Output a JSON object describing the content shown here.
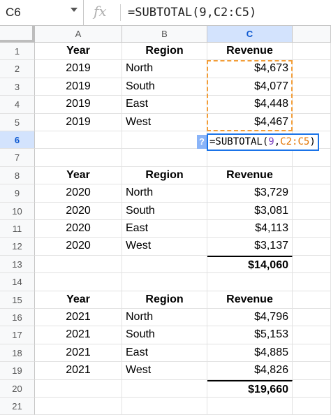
{
  "formula_bar": {
    "cell_ref": "C6",
    "fx_label": "fx",
    "formula": "=SUBTOTAL(9,C2:C5)"
  },
  "columns": [
    "A",
    "B",
    "C"
  ],
  "rows": [
    {
      "num": "1",
      "a": "Year",
      "b": "Region",
      "c": "Revenue",
      "header": true
    },
    {
      "num": "2",
      "a": "2019",
      "b": "North",
      "c": "$4,673"
    },
    {
      "num": "3",
      "a": "2019",
      "b": "South",
      "c": "$4,077"
    },
    {
      "num": "4",
      "a": "2019",
      "b": "East",
      "c": "$4,448"
    },
    {
      "num": "5",
      "a": "2019",
      "b": "West",
      "c": "$4,467"
    },
    {
      "num": "6",
      "a": "",
      "b": "",
      "c": ""
    },
    {
      "num": "7",
      "a": "",
      "b": "",
      "c": ""
    },
    {
      "num": "8",
      "a": "Year",
      "b": "Region",
      "c": "Revenue",
      "header": true
    },
    {
      "num": "9",
      "a": "2020",
      "b": "North",
      "c": "$3,729"
    },
    {
      "num": "10",
      "a": "2020",
      "b": "South",
      "c": "$3,081"
    },
    {
      "num": "11",
      "a": "2020",
      "b": "East",
      "c": "$4,113"
    },
    {
      "num": "12",
      "a": "2020",
      "b": "West",
      "c": "$3,137"
    },
    {
      "num": "13",
      "a": "",
      "b": "",
      "c": "$14,060",
      "total": true
    },
    {
      "num": "14",
      "a": "",
      "b": "",
      "c": ""
    },
    {
      "num": "15",
      "a": "Year",
      "b": "Region",
      "c": "Revenue",
      "header": true
    },
    {
      "num": "16",
      "a": "2021",
      "b": "North",
      "c": "$4,796"
    },
    {
      "num": "17",
      "a": "2021",
      "b": "South",
      "c": "$5,153"
    },
    {
      "num": "18",
      "a": "2021",
      "b": "East",
      "c": "$4,885"
    },
    {
      "num": "19",
      "a": "2021",
      "b": "West",
      "c": "$4,826"
    },
    {
      "num": "20",
      "a": "",
      "b": "",
      "c": "$19,660",
      "total": true
    },
    {
      "num": "21",
      "a": "",
      "b": "",
      "c": ""
    }
  ],
  "active_cell": "C6",
  "cell_editor": {
    "help_icon": "?",
    "prefix": "=SUBTOTAL(",
    "arg_num": "9",
    "comma": ",",
    "arg_range": "C2:C5",
    "suffix": ")"
  },
  "colors": {
    "selection_blue": "#1a73e8",
    "range_highlight": "#f29d38",
    "header_bg": "#f8f9fa"
  }
}
